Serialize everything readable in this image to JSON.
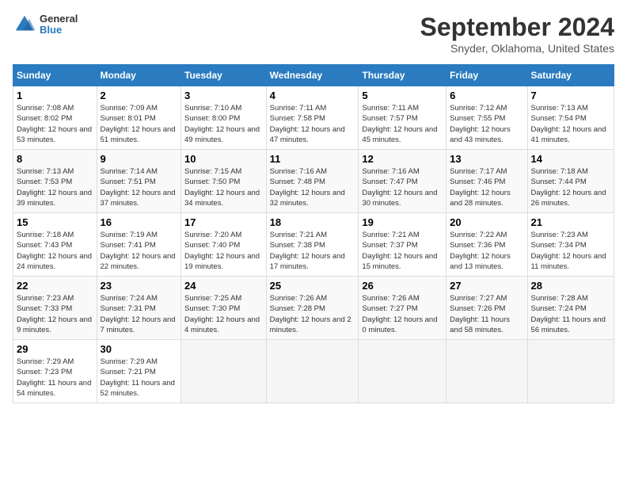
{
  "logo": {
    "general": "General",
    "blue": "Blue"
  },
  "title": "September 2024",
  "subtitle": "Snyder, Oklahoma, United States",
  "days_header": [
    "Sunday",
    "Monday",
    "Tuesday",
    "Wednesday",
    "Thursday",
    "Friday",
    "Saturday"
  ],
  "weeks": [
    [
      {
        "day": "1",
        "sunrise": "7:08 AM",
        "sunset": "8:02 PM",
        "daylight": "12 hours and 53 minutes."
      },
      {
        "day": "2",
        "sunrise": "7:09 AM",
        "sunset": "8:01 PM",
        "daylight": "12 hours and 51 minutes."
      },
      {
        "day": "3",
        "sunrise": "7:10 AM",
        "sunset": "8:00 PM",
        "daylight": "12 hours and 49 minutes."
      },
      {
        "day": "4",
        "sunrise": "7:11 AM",
        "sunset": "7:58 PM",
        "daylight": "12 hours and 47 minutes."
      },
      {
        "day": "5",
        "sunrise": "7:11 AM",
        "sunset": "7:57 PM",
        "daylight": "12 hours and 45 minutes."
      },
      {
        "day": "6",
        "sunrise": "7:12 AM",
        "sunset": "7:55 PM",
        "daylight": "12 hours and 43 minutes."
      },
      {
        "day": "7",
        "sunrise": "7:13 AM",
        "sunset": "7:54 PM",
        "daylight": "12 hours and 41 minutes."
      }
    ],
    [
      {
        "day": "8",
        "sunrise": "7:13 AM",
        "sunset": "7:53 PM",
        "daylight": "12 hours and 39 minutes."
      },
      {
        "day": "9",
        "sunrise": "7:14 AM",
        "sunset": "7:51 PM",
        "daylight": "12 hours and 37 minutes."
      },
      {
        "day": "10",
        "sunrise": "7:15 AM",
        "sunset": "7:50 PM",
        "daylight": "12 hours and 34 minutes."
      },
      {
        "day": "11",
        "sunrise": "7:16 AM",
        "sunset": "7:48 PM",
        "daylight": "12 hours and 32 minutes."
      },
      {
        "day": "12",
        "sunrise": "7:16 AM",
        "sunset": "7:47 PM",
        "daylight": "12 hours and 30 minutes."
      },
      {
        "day": "13",
        "sunrise": "7:17 AM",
        "sunset": "7:46 PM",
        "daylight": "12 hours and 28 minutes."
      },
      {
        "day": "14",
        "sunrise": "7:18 AM",
        "sunset": "7:44 PM",
        "daylight": "12 hours and 26 minutes."
      }
    ],
    [
      {
        "day": "15",
        "sunrise": "7:18 AM",
        "sunset": "7:43 PM",
        "daylight": "12 hours and 24 minutes."
      },
      {
        "day": "16",
        "sunrise": "7:19 AM",
        "sunset": "7:41 PM",
        "daylight": "12 hours and 22 minutes."
      },
      {
        "day": "17",
        "sunrise": "7:20 AM",
        "sunset": "7:40 PM",
        "daylight": "12 hours and 19 minutes."
      },
      {
        "day": "18",
        "sunrise": "7:21 AM",
        "sunset": "7:38 PM",
        "daylight": "12 hours and 17 minutes."
      },
      {
        "day": "19",
        "sunrise": "7:21 AM",
        "sunset": "7:37 PM",
        "daylight": "12 hours and 15 minutes."
      },
      {
        "day": "20",
        "sunrise": "7:22 AM",
        "sunset": "7:36 PM",
        "daylight": "12 hours and 13 minutes."
      },
      {
        "day": "21",
        "sunrise": "7:23 AM",
        "sunset": "7:34 PM",
        "daylight": "12 hours and 11 minutes."
      }
    ],
    [
      {
        "day": "22",
        "sunrise": "7:23 AM",
        "sunset": "7:33 PM",
        "daylight": "12 hours and 9 minutes."
      },
      {
        "day": "23",
        "sunrise": "7:24 AM",
        "sunset": "7:31 PM",
        "daylight": "12 hours and 7 minutes."
      },
      {
        "day": "24",
        "sunrise": "7:25 AM",
        "sunset": "7:30 PM",
        "daylight": "12 hours and 4 minutes."
      },
      {
        "day": "25",
        "sunrise": "7:26 AM",
        "sunset": "7:28 PM",
        "daylight": "12 hours and 2 minutes."
      },
      {
        "day": "26",
        "sunrise": "7:26 AM",
        "sunset": "7:27 PM",
        "daylight": "12 hours and 0 minutes."
      },
      {
        "day": "27",
        "sunrise": "7:27 AM",
        "sunset": "7:26 PM",
        "daylight": "11 hours and 58 minutes."
      },
      {
        "day": "28",
        "sunrise": "7:28 AM",
        "sunset": "7:24 PM",
        "daylight": "11 hours and 56 minutes."
      }
    ],
    [
      {
        "day": "29",
        "sunrise": "7:29 AM",
        "sunset": "7:23 PM",
        "daylight": "11 hours and 54 minutes."
      },
      {
        "day": "30",
        "sunrise": "7:29 AM",
        "sunset": "7:21 PM",
        "daylight": "11 hours and 52 minutes."
      },
      null,
      null,
      null,
      null,
      null
    ]
  ]
}
